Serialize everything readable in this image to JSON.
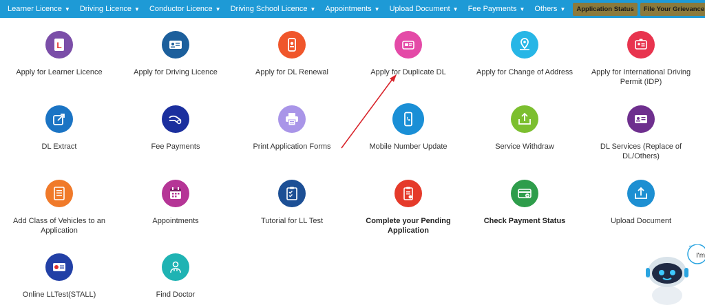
{
  "nav": {
    "items": [
      {
        "label": "Learner Licence"
      },
      {
        "label": "Driving Licence"
      },
      {
        "label": "Conductor Licence"
      },
      {
        "label": "Driving School Licence"
      },
      {
        "label": "Appointments"
      },
      {
        "label": "Upload Document"
      },
      {
        "label": "Fee Payments"
      },
      {
        "label": "Others"
      }
    ],
    "application_status": "Application Status",
    "file_grievance": "File Your Grievance"
  },
  "services": [
    {
      "label": "Apply for Learner Licence",
      "icon": "learner-licence-icon",
      "color": "#7b4ea8"
    },
    {
      "label": "Apply for Driving Licence",
      "icon": "driving-licence-icon",
      "color": "#1c5f9c"
    },
    {
      "label": "Apply for DL Renewal",
      "icon": "dl-renewal-icon",
      "color": "#f0562b"
    },
    {
      "label": "Apply for Duplicate DL",
      "icon": "duplicate-dl-icon",
      "color": "#e44aa7"
    },
    {
      "label": "Apply for Change of Address",
      "icon": "change-address-icon",
      "color": "#27b6e6"
    },
    {
      "label": "Apply for International Driving Permit (IDP)",
      "icon": "idp-icon",
      "color": "#e8344e"
    },
    {
      "label": "DL Extract",
      "icon": "dl-extract-icon",
      "color": "#1b74c4"
    },
    {
      "label": "Fee Payments",
      "icon": "fee-payments-icon",
      "color": "#1b2f9e"
    },
    {
      "label": "Print Application Forms",
      "icon": "print-icon",
      "color": "#a995e8"
    },
    {
      "label": "Mobile Number Update",
      "icon": "mobile-update-icon",
      "color": "#1a8fd6"
    },
    {
      "label": "Service Withdraw",
      "icon": "service-withdraw-icon",
      "color": "#7cbf2f"
    },
    {
      "label": "DL Services (Replace of DL/Others)",
      "icon": "dl-services-icon",
      "color": "#6e2f8e"
    },
    {
      "label": "Add Class of Vehicles to an Application",
      "icon": "add-class-icon",
      "color": "#f07a2a"
    },
    {
      "label": "Appointments",
      "icon": "appointments-icon",
      "color": "#b53596"
    },
    {
      "label": "Tutorial for LL Test",
      "icon": "tutorial-icon",
      "color": "#1c4f95"
    },
    {
      "label": "Complete your Pending Application",
      "icon": "pending-application-icon",
      "color": "#e53a2a",
      "bold": true
    },
    {
      "label": "Check Payment Status",
      "icon": "payment-status-icon",
      "color": "#2e9d4b",
      "bold": true
    },
    {
      "label": "Upload Document",
      "icon": "upload-document-icon",
      "color": "#1d8fd2"
    },
    {
      "label": "Online LLTest(STALL)",
      "icon": "online-lltest-icon",
      "color": "#2240a6"
    },
    {
      "label": "Find Doctor",
      "icon": "find-doctor-icon",
      "color": "#1fb3b3"
    }
  ],
  "bot": {
    "bubble_text": "I'm"
  }
}
